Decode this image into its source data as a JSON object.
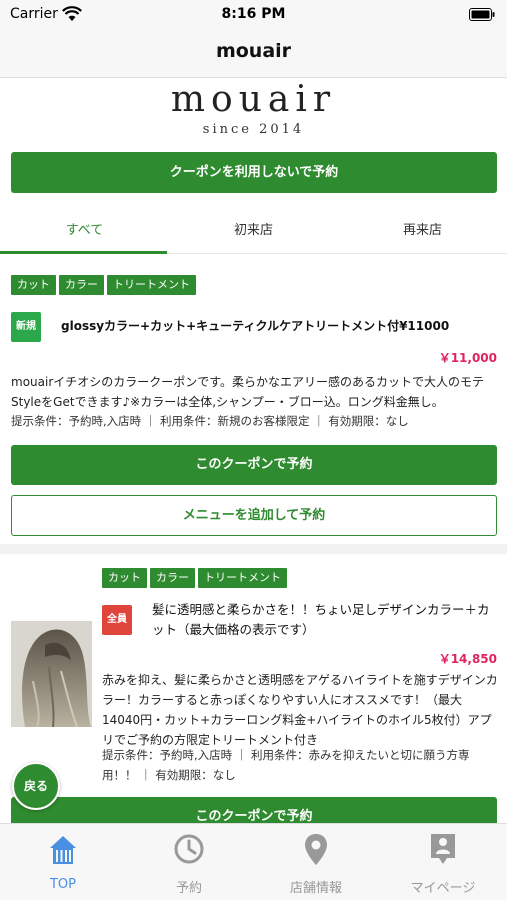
{
  "status_bar": {
    "carrier": "Carrier",
    "time": "8:16 PM"
  },
  "nav": {
    "title": "mouair"
  },
  "logo": {
    "name": "mouair",
    "since": "since 2014"
  },
  "top_button": "クーポンを利用しないで予約",
  "tabs": [
    {
      "label": "すべて",
      "active": true
    },
    {
      "label": "初来店",
      "active": false
    },
    {
      "label": "再来店",
      "active": false
    }
  ],
  "coupons": [
    {
      "tags": [
        "カット",
        "カラー",
        "トリートメント"
      ],
      "badge": "新規",
      "title": "glossyカラー+カット+キューティクルケアトリートメント付¥11000",
      "price": "￥11,000",
      "description": "mouairイチオシのカラークーポンです。柔らかなエアリー感のあるカットで大人のモテStyleをGetできます♪※カラーは全体,シャンプー・ブロー込。ロング料金無し。",
      "conditions": "提示条件：予約時,入店時 ｜ 利用条件：新規のお客様限定 ｜ 有効期限：なし",
      "reserve_label": "このクーポンで予約",
      "add_menu_label": "メニューを追加して予約"
    },
    {
      "tags": [
        "カット",
        "カラー",
        "トリートメント"
      ],
      "badge": "全員",
      "title": "髪に透明感と柔らかさを！！ちょい足しデザインカラー＋カット（最大価格の表示です）",
      "price": "￥14,850",
      "description": "赤みを抑え、髪に柔らかさと透明感をアゲるハイライトを施すデザインカラー！カラーすると赤っぽくなりやすい人にオススメです！（最大14040円・カット+カラーロング料金+ハイライトのホイル5枚付）アプリでご予約の方限定トリートメント付き",
      "conditions": "提示条件：予約時,入店時 ｜ 利用条件：赤みを抑えたいと切に願う方専用！！ ｜ 有効期限：なし",
      "reserve_label": "このクーポンで予約"
    }
  ],
  "back_button": "戻る",
  "tab_bar": [
    {
      "label": "TOP",
      "icon": "home-icon",
      "active": true
    },
    {
      "label": "予約",
      "icon": "clock-icon",
      "active": false
    },
    {
      "label": "店舗情報",
      "icon": "map-pin-icon",
      "active": false
    },
    {
      "label": "マイページ",
      "icon": "profile-icon",
      "active": false
    }
  ],
  "colors": {
    "accent": "#2f8b2f",
    "price": "#e0245e",
    "tab_active": "#4a90e2",
    "badge_new": "#2aa84a",
    "badge_all": "#e0453b"
  }
}
